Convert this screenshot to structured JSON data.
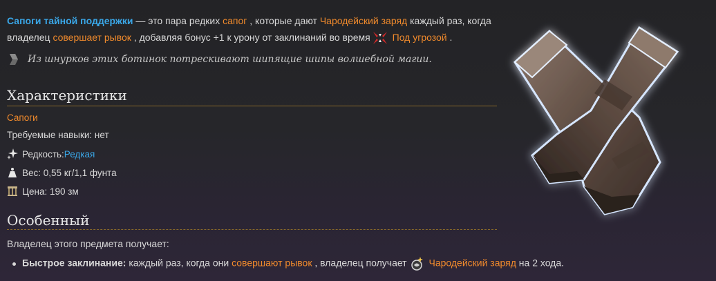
{
  "intro": {
    "item_name": "Сапоги тайной поддержки",
    "t1": " — это пара редких ",
    "boots_link": "сапог",
    "t2": " , которые дают ",
    "charge_link": "Чародейский заряд",
    "t3": " каждый раз, когда владелец ",
    "dash_link": "совершает рывок",
    "t4": " , добавляя бонус +1 к урону от заклинаний во время",
    "threat_link": "Под угрозой",
    "t5": " ."
  },
  "quote": "Из шнурков этих ботинок потрескивают шипящие шипы волшебной магии.",
  "characteristics": {
    "heading": "Характеристики",
    "type": "Сапоги",
    "skills": "Требуемые навыки: нет",
    "rarity_label": "Редкость: ",
    "rarity_value": "Редкая",
    "weight": "Вес: 0,55 кг/1,1 фунта",
    "price": "Цена: 190 зм"
  },
  "special": {
    "heading": "Особенный",
    "owner_text": "Владелец этого предмета получает:",
    "bullet_title": "Быстрое заклинание:",
    "b1": " каждый раз, когда они ",
    "dash_link": "совершают рывок",
    "b2": " , владелец получает",
    "charge_link": "Чародейский заряд",
    "b3": " на 2 хода."
  },
  "colors": {
    "link": "#f08a2c",
    "name": "#3aa7e8",
    "rule": "#8a6a2a"
  },
  "icons": [
    "quote-icon",
    "threat-icon",
    "rarity-icon",
    "weight-icon",
    "price-icon",
    "arcane-charge-icon",
    "boots-image"
  ]
}
